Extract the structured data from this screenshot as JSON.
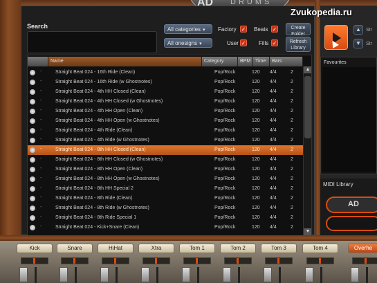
{
  "watermark": "Zvukopedia.ru",
  "logo": {
    "mark": "AD",
    "text": "DRUMS"
  },
  "search": {
    "label": "Search",
    "value": ""
  },
  "filters": {
    "categories": "All categories",
    "onesigns": "All onesigns",
    "factory": "Factory",
    "beats": "Beats",
    "user": "User",
    "fills": "Fills"
  },
  "buttons": {
    "create_folder": "Create Folder",
    "refresh_library": "Refresh Library"
  },
  "columns": {
    "name": "Name",
    "category": "Category",
    "bpm": "BPM",
    "time": "Time",
    "bars": "Bars"
  },
  "rows": [
    {
      "name": "Straight Beat 024 - 16th Ride (Clean)",
      "category": "Pop/Rock",
      "bpm": "120",
      "time": "4/4",
      "bars": "2"
    },
    {
      "name": "Straight Beat 024 - 16th Ride (w Ghostnotes)",
      "category": "Pop/Rock",
      "bpm": "120",
      "time": "4/4",
      "bars": "2"
    },
    {
      "name": "Straight Beat 024 - 4th HH Closed (Clean)",
      "category": "Pop/Rock",
      "bpm": "120",
      "time": "4/4",
      "bars": "2"
    },
    {
      "name": "Straight Beat 024 - 4th HH Closed (w Ghostnotes)",
      "category": "Pop/Rock",
      "bpm": "120",
      "time": "4/4",
      "bars": "2"
    },
    {
      "name": "Straight Beat 024 - 4th HH Open (Clean)",
      "category": "Pop/Rock",
      "bpm": "120",
      "time": "4/4",
      "bars": "2"
    },
    {
      "name": "Straight Beat 024 - 4th HH Open (w Ghostnotes)",
      "category": "Pop/Rock",
      "bpm": "120",
      "time": "4/4",
      "bars": "2"
    },
    {
      "name": "Straight Beat 024 - 4th Ride (Clean)",
      "category": "Pop/Rock",
      "bpm": "120",
      "time": "4/4",
      "bars": "2"
    },
    {
      "name": "Straight Beat 024 - 4th Ride (w Ghostnotes)",
      "category": "Pop/Rock",
      "bpm": "120",
      "time": "4/4",
      "bars": "2"
    },
    {
      "name": "Straight Beat 024 - 8th HH Closed (Clean)",
      "category": "Pop/Rock",
      "bpm": "120",
      "time": "4/4",
      "bars": "2",
      "selected": true
    },
    {
      "name": "Straight Beat 024 - 8th HH Closed (w Ghostnotes)",
      "category": "Pop/Rock",
      "bpm": "120",
      "time": "4/4",
      "bars": "2"
    },
    {
      "name": "Straight Beat 024 - 8th HH Open (Clean)",
      "category": "Pop/Rock",
      "bpm": "120",
      "time": "4/4",
      "bars": "2"
    },
    {
      "name": "Straight Beat 024 - 8th HH Open (w Ghostnotes)",
      "category": "Pop/Rock",
      "bpm": "120",
      "time": "4/4",
      "bars": "2"
    },
    {
      "name": "Straight Beat 024 - 8th HH Special 2",
      "category": "Pop/Rock",
      "bpm": "120",
      "time": "4/4",
      "bars": "2"
    },
    {
      "name": "Straight Beat 024 - 8th Ride (Clean)",
      "category": "Pop/Rock",
      "bpm": "120",
      "time": "4/4",
      "bars": "2"
    },
    {
      "name": "Straight Beat 024 - 8th Ride (w Ghostnotes)",
      "category": "Pop/Rock",
      "bpm": "120",
      "time": "4/4",
      "bars": "2"
    },
    {
      "name": "Straight Beat 024 - 8th Ride Special 1",
      "category": "Pop/Rock",
      "bpm": "120",
      "time": "4/4",
      "bars": "2"
    },
    {
      "name": "Straight Beat 024 - Kick+Snare (Clean)",
      "category": "Pop/Rock",
      "bpm": "120",
      "time": "4/4",
      "bars": "2"
    }
  ],
  "right_panel": {
    "favourites_label": "Favourites",
    "midi_label": "MIDI Library",
    "stub_top": "Str",
    "stub_bottom": "Str"
  },
  "channels": [
    "Kick",
    "Snare",
    "HiHat",
    "Xtra",
    "Tom 1",
    "Tom 2",
    "Tom 3",
    "Tom 4",
    "Overhe"
  ],
  "colors": {
    "accent": "#d84c10",
    "selected_row": "#e2772c",
    "wood": "#8a4e26"
  }
}
